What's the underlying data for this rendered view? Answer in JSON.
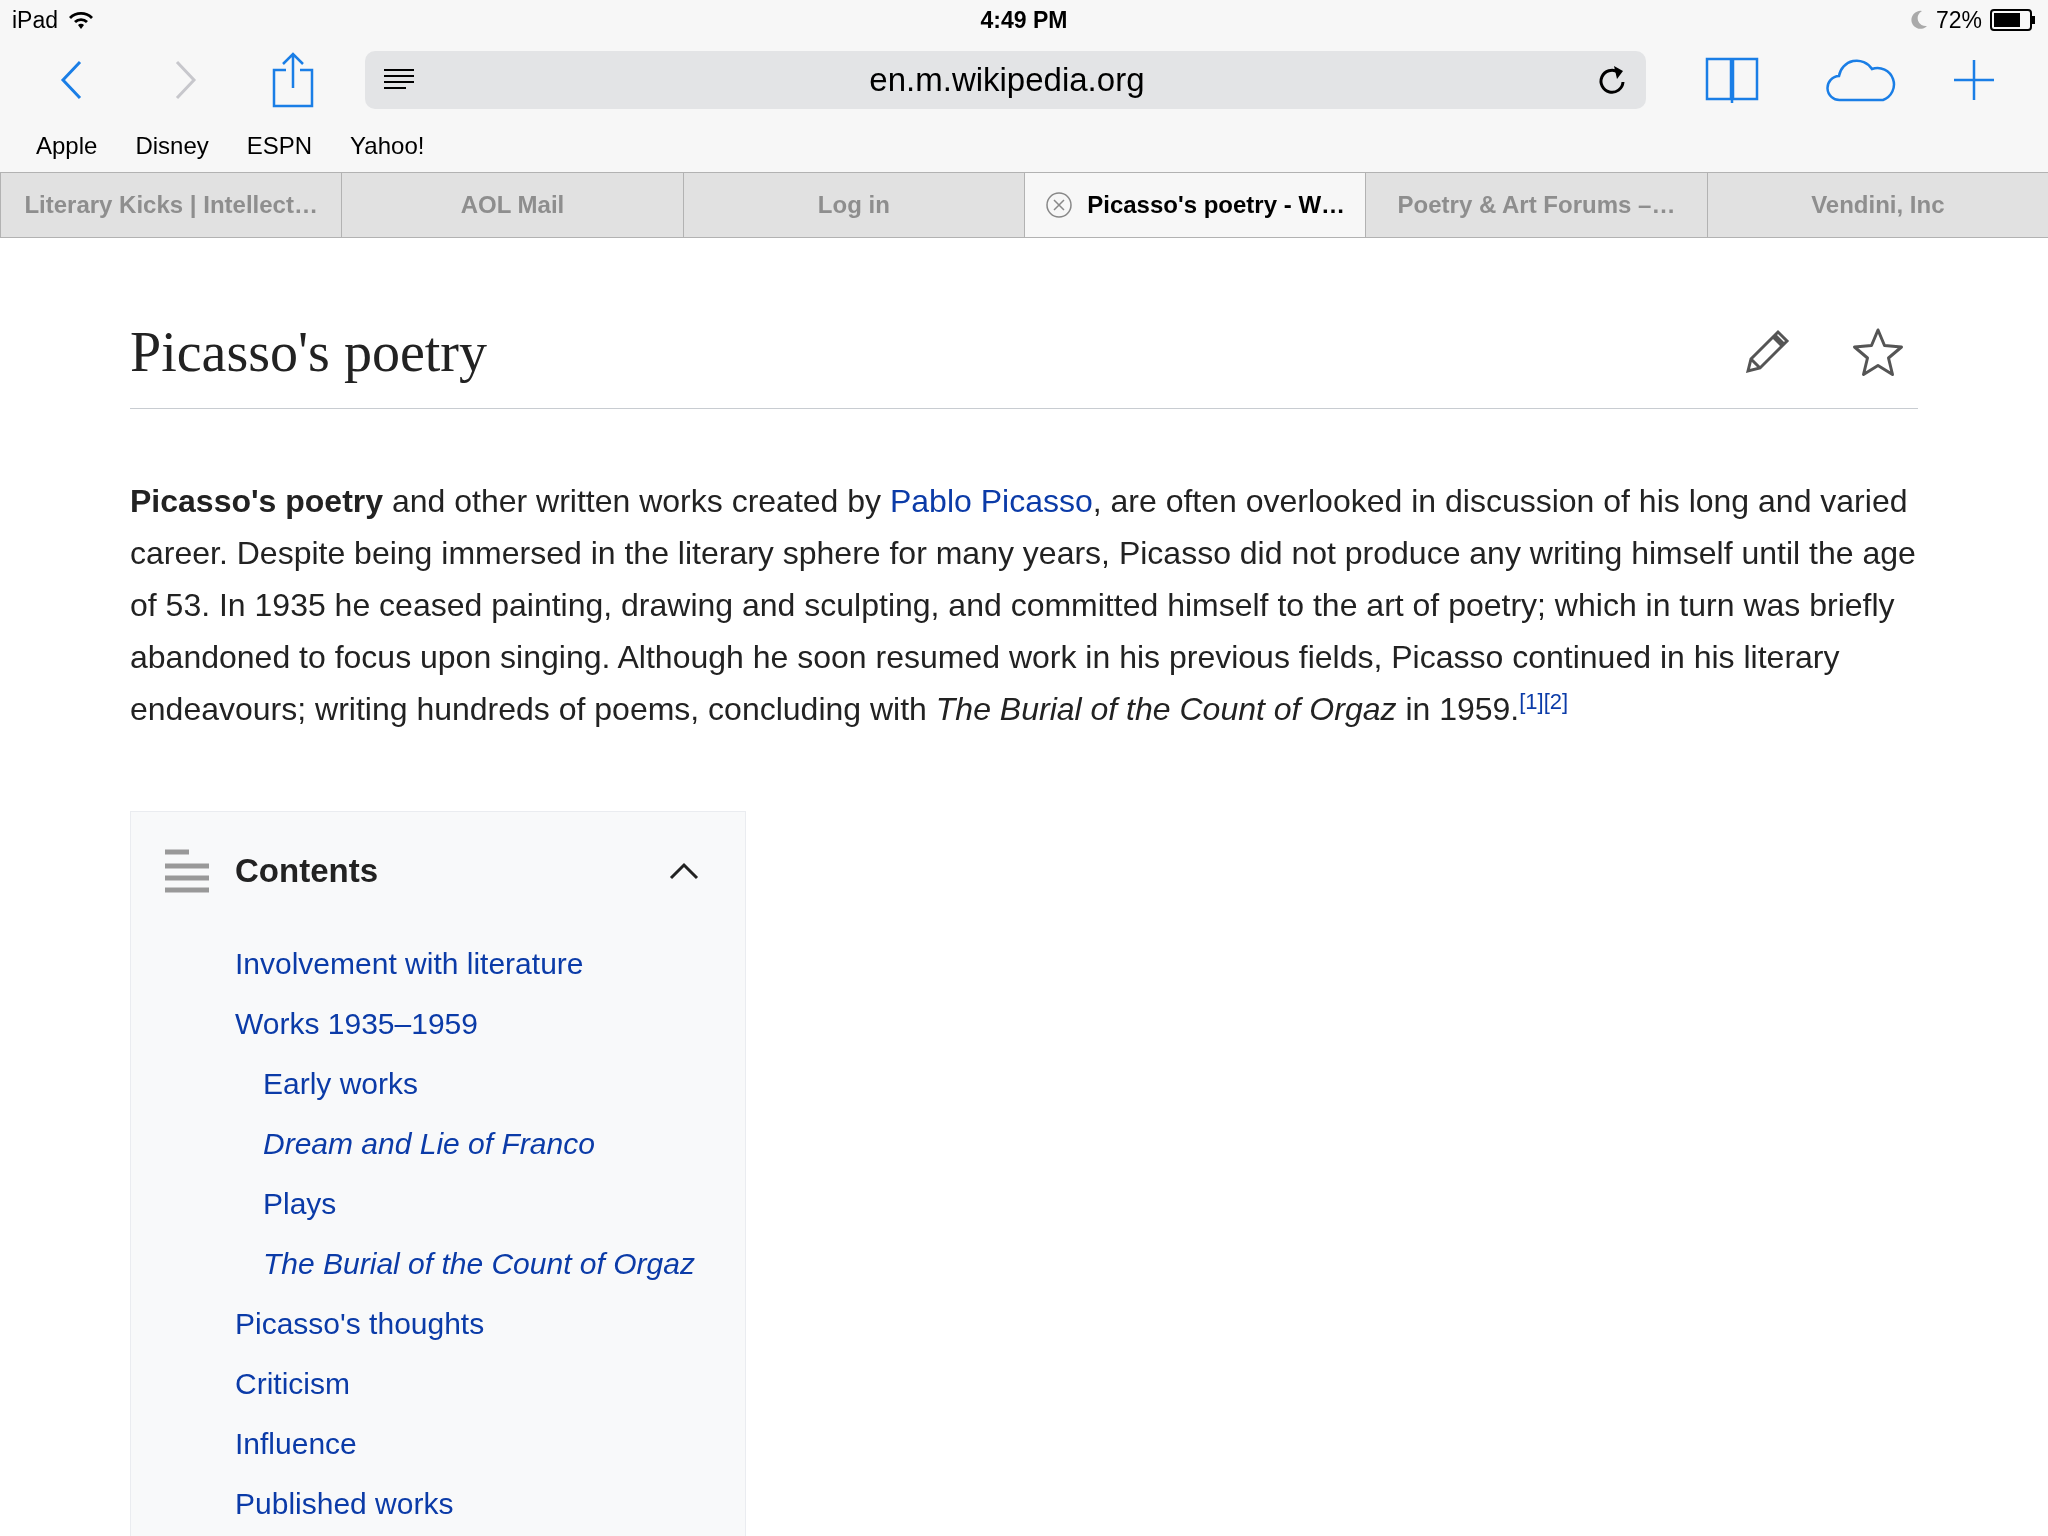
{
  "status_bar": {
    "device": "iPad",
    "time": "4:49 PM",
    "battery": "72%"
  },
  "toolbar": {
    "url": "en.m.wikipedia.org"
  },
  "bookmarks": [
    "Apple",
    "Disney",
    "ESPN",
    "Yahoo!"
  ],
  "tabs": [
    {
      "label": "Literary Kicks | Intellect…",
      "selected": false
    },
    {
      "label": "AOL Mail",
      "selected": false
    },
    {
      "label": "Log in",
      "selected": false
    },
    {
      "label": "Picasso's poetry - W…",
      "selected": true
    },
    {
      "label": "Poetry & Art Forums –…",
      "selected": false
    },
    {
      "label": "Vendini, Inc",
      "selected": false
    }
  ],
  "article": {
    "title": "Picasso's poetry",
    "intro": [
      {
        "kind": "bold",
        "text": "Picasso's poetry"
      },
      {
        "kind": "text",
        "text": " and other written works created by "
      },
      {
        "kind": "link",
        "text": "Pablo Picasso"
      },
      {
        "kind": "text",
        "text": ", are often overlooked in discussion of his long and varied career. Despite being immersed in the literary sphere for many years, Picasso did not produce any writing himself until the age of 53. In 1935 he ceased painting, drawing and sculpting, and committed himself to the art of poetry; which in turn was briefly abandoned to focus upon singing. Although he soon resumed work in his previous fields, Picasso continued in his literary endeavours; writing hundreds of poems, concluding with "
      },
      {
        "kind": "italic",
        "text": "The Burial of the Count of Orgaz"
      },
      {
        "kind": "text",
        "text": " in 1959."
      },
      {
        "kind": "ref",
        "text": "[1][2]"
      }
    ]
  },
  "contents": {
    "title": "Contents",
    "expanded": true,
    "items": [
      {
        "label": "Involvement with literature",
        "italic": false
      },
      {
        "label": "Works 1935–1959",
        "italic": false,
        "children": [
          {
            "label": "Early works",
            "italic": false
          },
          {
            "label": "Dream and Lie of Franco",
            "italic": true
          },
          {
            "label": "Plays",
            "italic": false
          },
          {
            "label": "The Burial of the Count of Orgaz",
            "italic": true
          }
        ]
      },
      {
        "label": "Picasso's thoughts",
        "italic": false
      },
      {
        "label": "Criticism",
        "italic": false
      },
      {
        "label": "Influence",
        "italic": false
      },
      {
        "label": "Published works",
        "italic": false
      }
    ]
  }
}
